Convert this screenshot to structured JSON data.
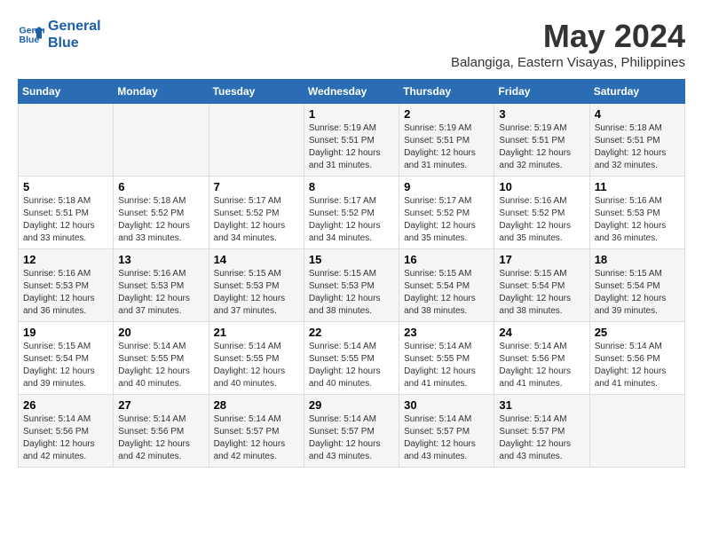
{
  "header": {
    "logo_line1": "General",
    "logo_line2": "Blue",
    "month_title": "May 2024",
    "subtitle": "Balangiga, Eastern Visayas, Philippines"
  },
  "days_of_week": [
    "Sunday",
    "Monday",
    "Tuesday",
    "Wednesday",
    "Thursday",
    "Friday",
    "Saturday"
  ],
  "weeks": [
    [
      {
        "day": "",
        "info": ""
      },
      {
        "day": "",
        "info": ""
      },
      {
        "day": "",
        "info": ""
      },
      {
        "day": "1",
        "info": "Sunrise: 5:19 AM\nSunset: 5:51 PM\nDaylight: 12 hours\nand 31 minutes."
      },
      {
        "day": "2",
        "info": "Sunrise: 5:19 AM\nSunset: 5:51 PM\nDaylight: 12 hours\nand 31 minutes."
      },
      {
        "day": "3",
        "info": "Sunrise: 5:19 AM\nSunset: 5:51 PM\nDaylight: 12 hours\nand 32 minutes."
      },
      {
        "day": "4",
        "info": "Sunrise: 5:18 AM\nSunset: 5:51 PM\nDaylight: 12 hours\nand 32 minutes."
      }
    ],
    [
      {
        "day": "5",
        "info": "Sunrise: 5:18 AM\nSunset: 5:51 PM\nDaylight: 12 hours\nand 33 minutes."
      },
      {
        "day": "6",
        "info": "Sunrise: 5:18 AM\nSunset: 5:52 PM\nDaylight: 12 hours\nand 33 minutes."
      },
      {
        "day": "7",
        "info": "Sunrise: 5:17 AM\nSunset: 5:52 PM\nDaylight: 12 hours\nand 34 minutes."
      },
      {
        "day": "8",
        "info": "Sunrise: 5:17 AM\nSunset: 5:52 PM\nDaylight: 12 hours\nand 34 minutes."
      },
      {
        "day": "9",
        "info": "Sunrise: 5:17 AM\nSunset: 5:52 PM\nDaylight: 12 hours\nand 35 minutes."
      },
      {
        "day": "10",
        "info": "Sunrise: 5:16 AM\nSunset: 5:52 PM\nDaylight: 12 hours\nand 35 minutes."
      },
      {
        "day": "11",
        "info": "Sunrise: 5:16 AM\nSunset: 5:53 PM\nDaylight: 12 hours\nand 36 minutes."
      }
    ],
    [
      {
        "day": "12",
        "info": "Sunrise: 5:16 AM\nSunset: 5:53 PM\nDaylight: 12 hours\nand 36 minutes."
      },
      {
        "day": "13",
        "info": "Sunrise: 5:16 AM\nSunset: 5:53 PM\nDaylight: 12 hours\nand 37 minutes."
      },
      {
        "day": "14",
        "info": "Sunrise: 5:15 AM\nSunset: 5:53 PM\nDaylight: 12 hours\nand 37 minutes."
      },
      {
        "day": "15",
        "info": "Sunrise: 5:15 AM\nSunset: 5:53 PM\nDaylight: 12 hours\nand 38 minutes."
      },
      {
        "day": "16",
        "info": "Sunrise: 5:15 AM\nSunset: 5:54 PM\nDaylight: 12 hours\nand 38 minutes."
      },
      {
        "day": "17",
        "info": "Sunrise: 5:15 AM\nSunset: 5:54 PM\nDaylight: 12 hours\nand 38 minutes."
      },
      {
        "day": "18",
        "info": "Sunrise: 5:15 AM\nSunset: 5:54 PM\nDaylight: 12 hours\nand 39 minutes."
      }
    ],
    [
      {
        "day": "19",
        "info": "Sunrise: 5:15 AM\nSunset: 5:54 PM\nDaylight: 12 hours\nand 39 minutes."
      },
      {
        "day": "20",
        "info": "Sunrise: 5:14 AM\nSunset: 5:55 PM\nDaylight: 12 hours\nand 40 minutes."
      },
      {
        "day": "21",
        "info": "Sunrise: 5:14 AM\nSunset: 5:55 PM\nDaylight: 12 hours\nand 40 minutes."
      },
      {
        "day": "22",
        "info": "Sunrise: 5:14 AM\nSunset: 5:55 PM\nDaylight: 12 hours\nand 40 minutes."
      },
      {
        "day": "23",
        "info": "Sunrise: 5:14 AM\nSunset: 5:55 PM\nDaylight: 12 hours\nand 41 minutes."
      },
      {
        "day": "24",
        "info": "Sunrise: 5:14 AM\nSunset: 5:56 PM\nDaylight: 12 hours\nand 41 minutes."
      },
      {
        "day": "25",
        "info": "Sunrise: 5:14 AM\nSunset: 5:56 PM\nDaylight: 12 hours\nand 41 minutes."
      }
    ],
    [
      {
        "day": "26",
        "info": "Sunrise: 5:14 AM\nSunset: 5:56 PM\nDaylight: 12 hours\nand 42 minutes."
      },
      {
        "day": "27",
        "info": "Sunrise: 5:14 AM\nSunset: 5:56 PM\nDaylight: 12 hours\nand 42 minutes."
      },
      {
        "day": "28",
        "info": "Sunrise: 5:14 AM\nSunset: 5:57 PM\nDaylight: 12 hours\nand 42 minutes."
      },
      {
        "day": "29",
        "info": "Sunrise: 5:14 AM\nSunset: 5:57 PM\nDaylight: 12 hours\nand 43 minutes."
      },
      {
        "day": "30",
        "info": "Sunrise: 5:14 AM\nSunset: 5:57 PM\nDaylight: 12 hours\nand 43 minutes."
      },
      {
        "day": "31",
        "info": "Sunrise: 5:14 AM\nSunset: 5:57 PM\nDaylight: 12 hours\nand 43 minutes."
      },
      {
        "day": "",
        "info": ""
      }
    ]
  ]
}
